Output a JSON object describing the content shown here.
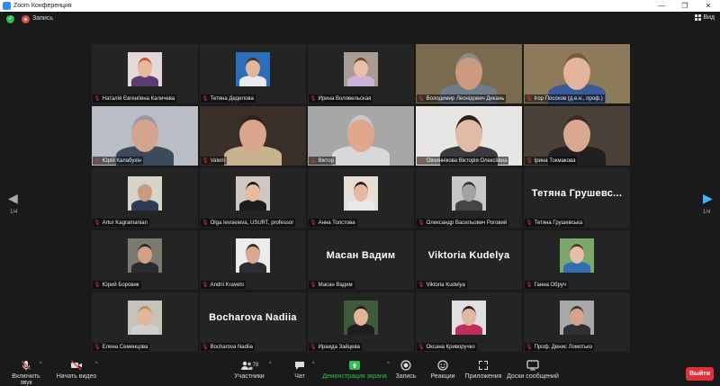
{
  "window": {
    "title": "Zoom Конференция"
  },
  "status": {
    "record_label": "Запись",
    "view_label": "Вид"
  },
  "colors": {
    "accent": "#2d8cff",
    "active_speaker": "#d8d436",
    "leave": "#e0303a",
    "muted": "#e03b3b"
  },
  "pager": {
    "left": "1/4",
    "right": "1/4"
  },
  "participants": [
    {
      "name": "Наталія Євгеніївна Каличева"
    },
    {
      "name": "Тетяна Дедилова"
    },
    {
      "name": "Ирина Воловельская"
    },
    {
      "name": "Володимир Леонідович Дикань"
    },
    {
      "name": "Ігор Посохов (д.е.н., проф.)"
    },
    {
      "name": "Юрій Калабухін"
    },
    {
      "name": "Valerii"
    },
    {
      "name": "Віктор"
    },
    {
      "name": "Овчиннікова Вікторія Олексіївна"
    },
    {
      "name": "Ірина Токмакова"
    },
    {
      "name": "Artur Kagramanian"
    },
    {
      "name": "Olga Ievsieieva, USURT, professor"
    },
    {
      "name": "Анна Толстова"
    },
    {
      "name": "Олександр Васильович Роговий"
    },
    {
      "name": "Тетяна Грушевська",
      "big": "Тетяна Грушевс..."
    },
    {
      "name": "Юрий Боровик"
    },
    {
      "name": "Andrii Kravets"
    },
    {
      "name": "Масан Вадим",
      "big": "Масан Вадим"
    },
    {
      "name": "Viktoria Kudelya",
      "big": "Viktoria Kudelya"
    },
    {
      "name": "Ганна Обруч"
    },
    {
      "name": "Елена Семенцова"
    },
    {
      "name": "Bocharova Nadiia",
      "big": "Bocharova Nadiia"
    },
    {
      "name": "Ираида Зайцева"
    },
    {
      "name": "Оксана Криворучко"
    },
    {
      "name": "Проф. Денис Ломотько"
    }
  ],
  "toolbar": {
    "unmute": "Включить звук",
    "start_video": "Начать видео",
    "participants": "Участники",
    "participants_count": "78",
    "chat": "Чат",
    "share": "Демонстрация экрана",
    "record": "Запись",
    "reactions": "Реакции",
    "apps": "Приложения",
    "whiteboards": "Доски сообщений",
    "leave": "Выйти"
  }
}
